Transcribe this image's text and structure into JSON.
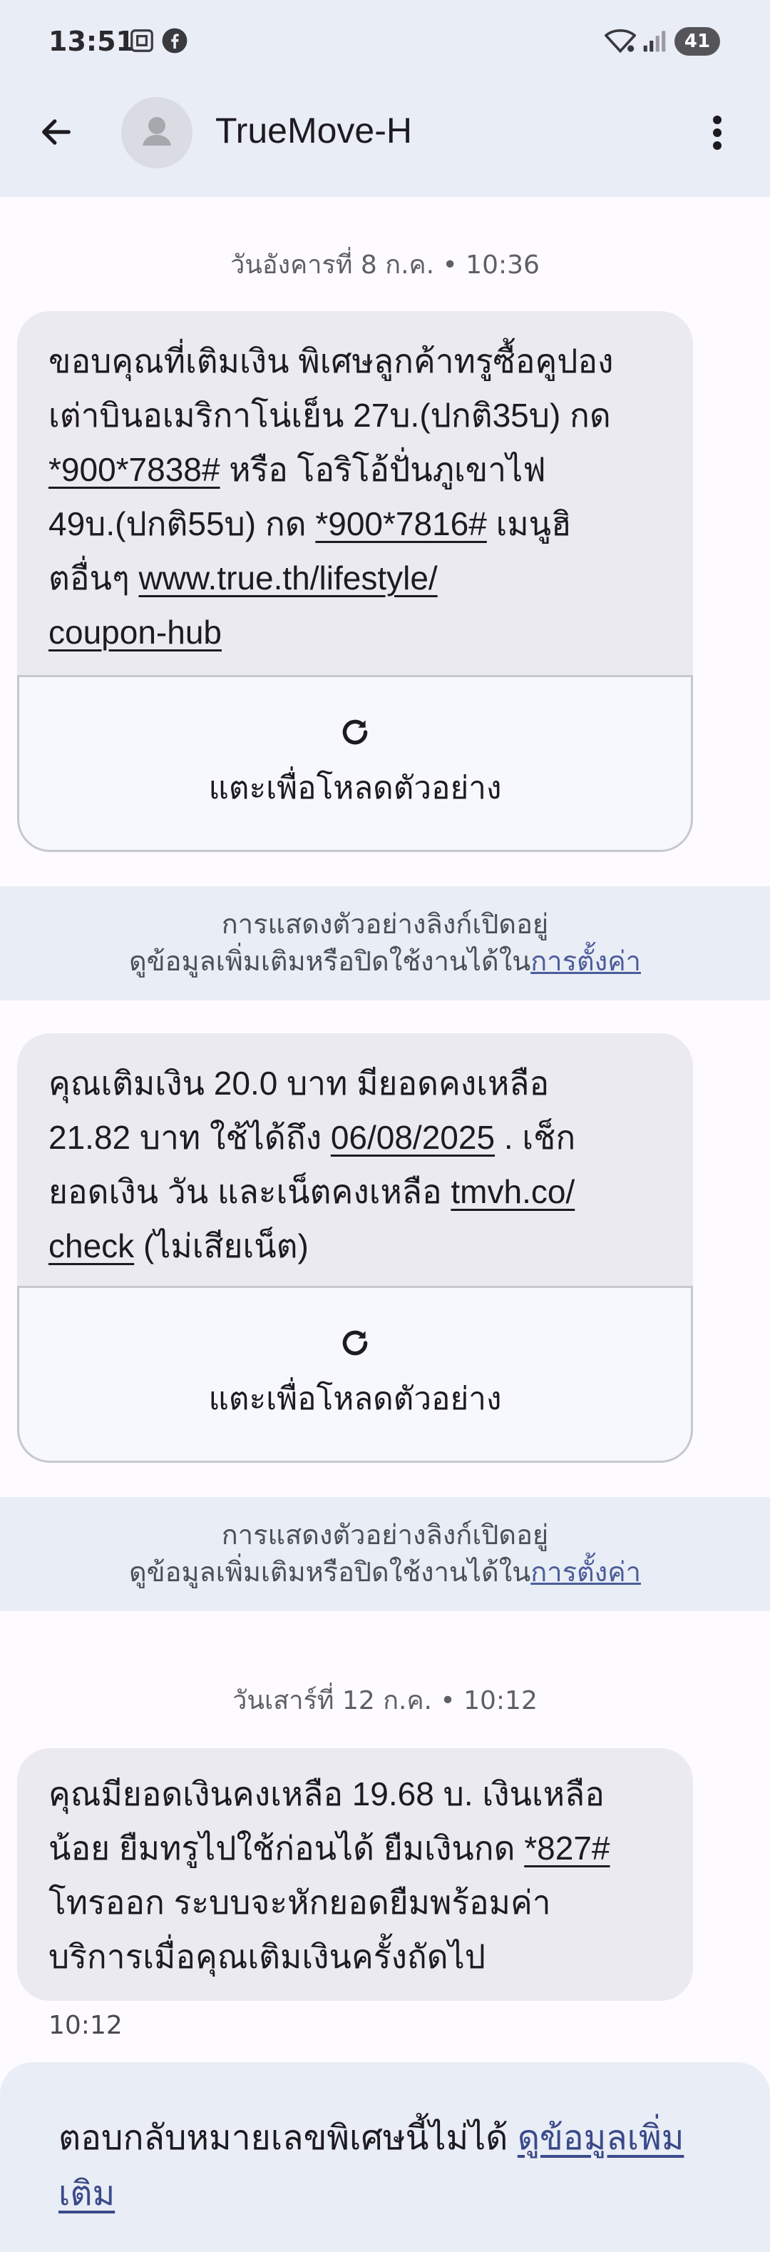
{
  "status_bar": {
    "time": "13:51",
    "battery": "41",
    "icons": [
      "screenshot-icon",
      "facebook-icon",
      "wifi-icon",
      "signal-icon"
    ]
  },
  "app_bar": {
    "title": "TrueMove-H"
  },
  "messages": [
    {
      "date": "วันอังคารที่ 8 ก.ค. • 10:36",
      "lines": [
        {
          "text": "ขอบคุณที่เติมเงิน พิเศษลูกค้าทรูซื้อคูปอง"
        },
        {
          "text": "เต่าบินอเมริกาโน่เย็น 27บ.(ปกติ35บ) กด"
        },
        {
          "code": "*900*7838#",
          "text": " หรือ โอริโอ้ปั่นภูเขาไฟ"
        },
        {
          "text": "49บ.(ปกติ55บ) กด ",
          "code": "*900*7816#",
          "tail": " เมนูฮิ"
        },
        {
          "text": "ตอื่นๆ ",
          "link": "www.true.th/lifestyle/"
        },
        {
          "link": "coupon-hub"
        }
      ],
      "preview_label": "แตะเพื่อโหลดตัวอย่าง"
    },
    {
      "lines": [
        {
          "text": "คุณเติมเงิน 20.0 บาท มียอดคงเหลือ"
        },
        {
          "text": "21.82 บาท ใช้ได้ถึง ",
          "link": "06/08/2025",
          "tail": " . เช็ก"
        },
        {
          "text": "ยอดเงิน วัน และเน็ตคงเหลือ ",
          "link": "tmvh.co/"
        },
        {
          "link": "check",
          "tail": " (ไม่เสียเน็ต)"
        }
      ],
      "preview_label": "แตะเพื่อโหลดตัวอย่าง"
    },
    {
      "date": "วันเสาร์ที่ 12 ก.ค. • 10:12",
      "lines": [
        {
          "text": "คุณมียอดเงินคงเหลือ 19.68 บ. เงินเหลือ"
        },
        {
          "text": "น้อย ยืมทรูไปใช้ก่อนได้ ยืมเงินกด ",
          "link": "*827#"
        },
        {
          "text": "โทรออก ระบบจะหักยอดยืมพร้อมค่า"
        },
        {
          "text": "บริการเมื่อคุณเติมเงินครั้งถัดไป"
        }
      ],
      "time": "10:12"
    }
  ],
  "banner": {
    "line1": "การแสดงตัวอย่างลิงก์เปิดอยู่",
    "line2": "ดูข้อมูลเพิ่มเติมหรือปิดใช้งานได้ใน",
    "settings_link": "การตั้งค่า"
  },
  "footer": {
    "text": "ตอบกลับหมายเลขพิเศษนี้ไม่ได้ ",
    "more_link": "ดูข้อมูลเพิ่ม",
    "more_link_2": "เติม"
  }
}
